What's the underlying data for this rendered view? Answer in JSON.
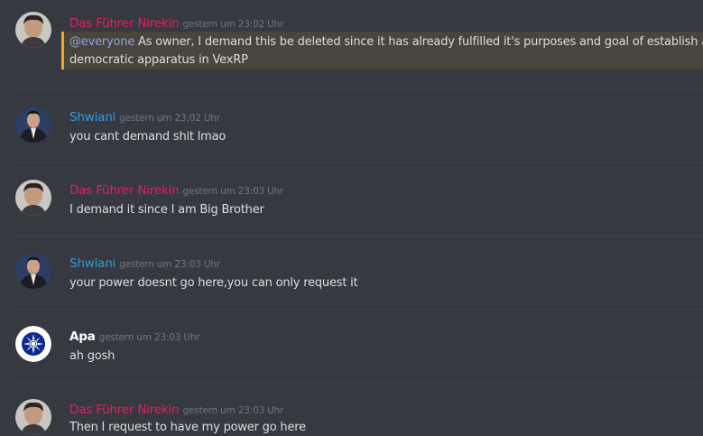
{
  "colors": {
    "background": "#36393f",
    "nirekin": "#e91e63",
    "shwiani": "#3498db",
    "apa": "#ffffff",
    "timestamp": "#72767d",
    "text": "#dcddde",
    "mention_highlight": "#49443c",
    "mention_bar": "#faa61a",
    "mention_text": "#8ea1e1"
  },
  "messages": [
    {
      "author": "Das Führer Nirekin",
      "timestamp": "gestern um 23:02 Uhr",
      "mention": "@everyone",
      "line1": " As owner, I demand this be deleted since it has already fulfilled it's purposes and goal of establish a",
      "line2": "democratic apparatus in VexRP"
    },
    {
      "author": "Shwiani",
      "timestamp": "gestern um 23:02 Uhr",
      "text": "you cant demand shit lmao"
    },
    {
      "author": "Das Führer Nirekin",
      "timestamp": "gestern um 23:03 Uhr",
      "text": "I demand it since I am Big Brother"
    },
    {
      "author": "Shwiani",
      "timestamp": "gestern um 23:03 Uhr",
      "text": "your power doesnt go here,you can only request it"
    },
    {
      "author": "Apa",
      "timestamp": "gestern um 23:03 Uhr",
      "text": "ah gosh"
    },
    {
      "author": "Das Führer Nirekin",
      "timestamp": "gestern um 23:03 Uhr",
      "text": "Then I request to have my power go here"
    }
  ]
}
